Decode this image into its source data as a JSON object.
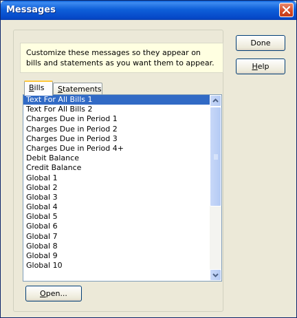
{
  "window": {
    "title": "Messages"
  },
  "info": {
    "text": "Customize these messages so they appear on bills and statements as you want them to appear."
  },
  "buttons": {
    "done": "Done",
    "help_first": "H",
    "help_rest": "elp",
    "open_first": "O",
    "open_rest": "pen..."
  },
  "tabs": {
    "bills_first": "B",
    "bills_rest": "ills",
    "statements_first": "S",
    "statements_rest": "tatements"
  },
  "list": {
    "items": [
      "Text For All Bills 1",
      "Text For All Bills 2",
      "Charges Due in Period 1",
      "Charges Due in Period 2",
      "Charges Due in Period 3",
      "Charges Due in Period 4+",
      "Debit Balance",
      "Credit Balance",
      "Global 1",
      "Global 2",
      "Global 3",
      "Global 4",
      "Global 5",
      "Global 6",
      "Global 7",
      "Global 8",
      "Global 9",
      "Global 10"
    ],
    "selected_index": 0
  },
  "icons": {
    "close": "close-icon",
    "scroll_up": "chevron-up-icon",
    "scroll_down": "chevron-down-icon"
  }
}
